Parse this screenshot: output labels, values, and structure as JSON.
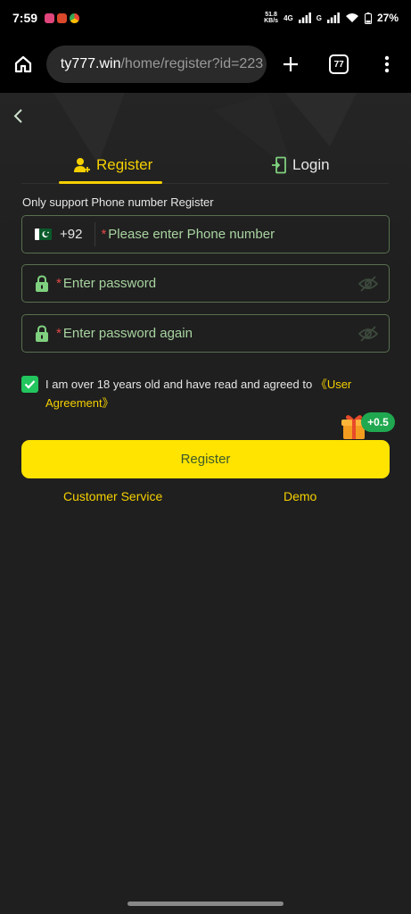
{
  "status_bar": {
    "time": "7:59",
    "net_speed_value": "51.8",
    "net_speed_unit": "KB/s",
    "network_tag": "4G",
    "wifi_tag": "G",
    "battery": "27%"
  },
  "browser": {
    "url_host": "ty777.win",
    "url_path": "/home/register?id=223",
    "tab_count": "77"
  },
  "tabs": {
    "register": "Register",
    "login": "Login"
  },
  "hint": "Only support Phone number Register",
  "form": {
    "country_code": "+92",
    "required_mark": "*",
    "phone_placeholder": "Please enter Phone number",
    "password_placeholder": "Enter password",
    "password_again_placeholder": "Enter password again"
  },
  "agreement": {
    "text": "I am over 18 years old and have read and agreed to ",
    "link": "《User Agreement》",
    "checked": true
  },
  "bonus": "+0.5",
  "register_button": "Register",
  "footer": {
    "customer_service": "Customer Service",
    "demo": "Demo"
  },
  "colors": {
    "accent": "#f5d000",
    "button": "#ffe400",
    "field_border": "#58704f",
    "checkbox": "#22c55e",
    "bonus": "#1fa84f"
  }
}
